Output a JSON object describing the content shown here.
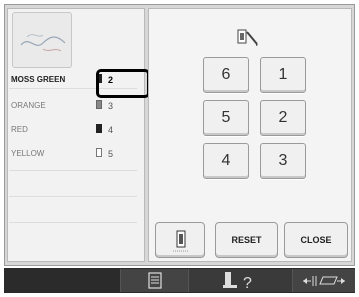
{
  "threads": [
    {
      "name": "MOSS GREEN",
      "number": "2",
      "selected": true
    },
    {
      "name": "ORANGE",
      "number": "3"
    },
    {
      "name": "RED",
      "number": "4"
    },
    {
      "name": "YELLOW",
      "number": "5"
    }
  ],
  "keypad": [
    "6",
    "1",
    "5",
    "2",
    "4",
    "3"
  ],
  "buttons": {
    "reset": "RESET",
    "close": "CLOSE"
  },
  "icons": {
    "preview": "embroidery-pattern-preview",
    "spool_pencil": "spool-edit-icon",
    "spool_button": "spool-order-icon",
    "bottom": [
      "document-icon",
      "help-icon",
      "width-adjust-icon"
    ]
  },
  "colors": {
    "highlight": "#000000",
    "bottom_bar": "#2b2b2b"
  }
}
